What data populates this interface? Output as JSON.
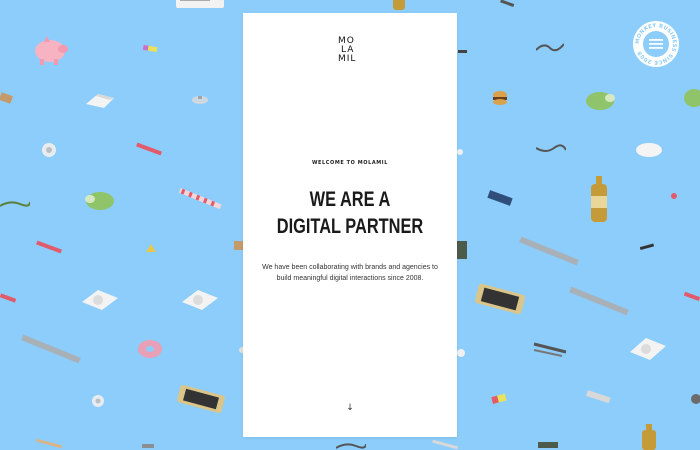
{
  "brand": {
    "logo_lines": [
      "MO",
      "LA",
      "MIL"
    ]
  },
  "hero": {
    "eyebrow": "WELCOME TO MOLAMIL",
    "headline_line1": "WE ARE A",
    "headline_line2": "DIGITAL PARTNER",
    "description_line1": "We have been collaborating with brands and agencies to",
    "description_line2": "build meaningful digital interactions since 2008.",
    "scroll_arrow": "↓"
  },
  "badge": {
    "text": "MONKEY BUSINESS SINCE 2008",
    "icon": "hamburger-menu-icon",
    "color": "#8ccdfb"
  },
  "colors": {
    "background": "#8ccdfb",
    "card": "#ffffff",
    "text": "#1a1a1a"
  }
}
